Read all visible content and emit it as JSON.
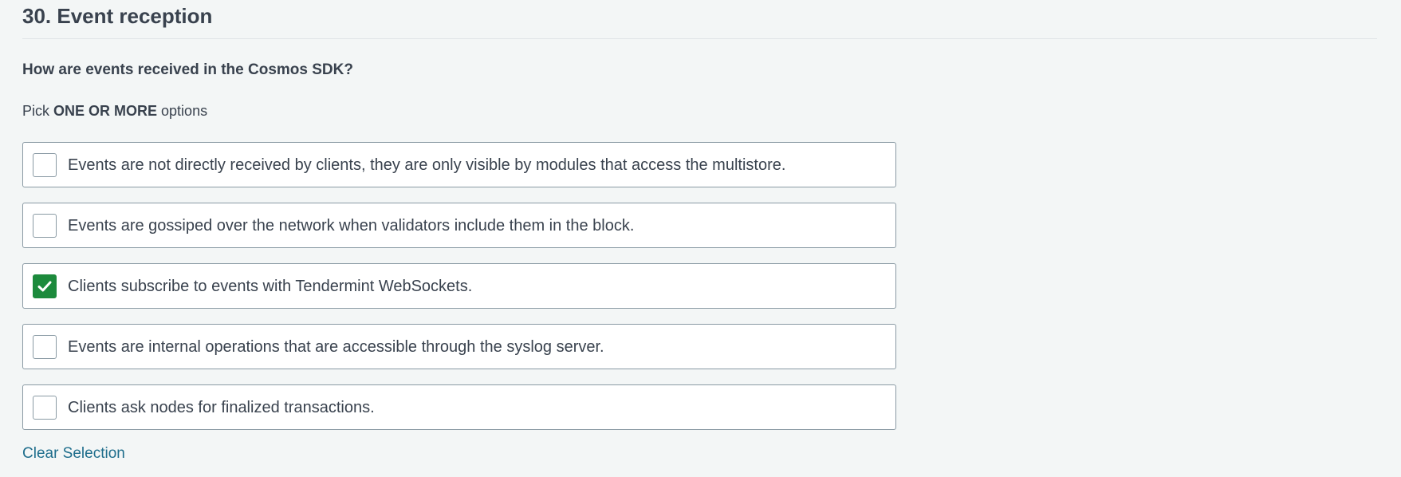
{
  "question": {
    "title": "30. Event reception",
    "text": "How are events received in the Cosmos SDK?",
    "instruction_prefix": "Pick ",
    "instruction_emphasis": "ONE OR MORE",
    "instruction_suffix": " options"
  },
  "options": [
    {
      "label": "Events are not directly received by clients, they are only visible by modules that access the multistore.",
      "checked": false
    },
    {
      "label": "Events are gossiped over the network when validators include them in the block.",
      "checked": false
    },
    {
      "label": "Clients subscribe to events with Tendermint WebSockets.",
      "checked": true
    },
    {
      "label": "Events are internal operations that are accessible through the syslog server.",
      "checked": false
    },
    {
      "label": "Clients ask nodes for finalized transactions.",
      "checked": false
    }
  ],
  "actions": {
    "clear_label": "Clear Selection"
  },
  "colors": {
    "checked": "#1c8a3c",
    "link": "#1f6e8c",
    "background": "#f3f6f6"
  },
  "icons": {
    "checked_mark": "checkmark-icon"
  }
}
